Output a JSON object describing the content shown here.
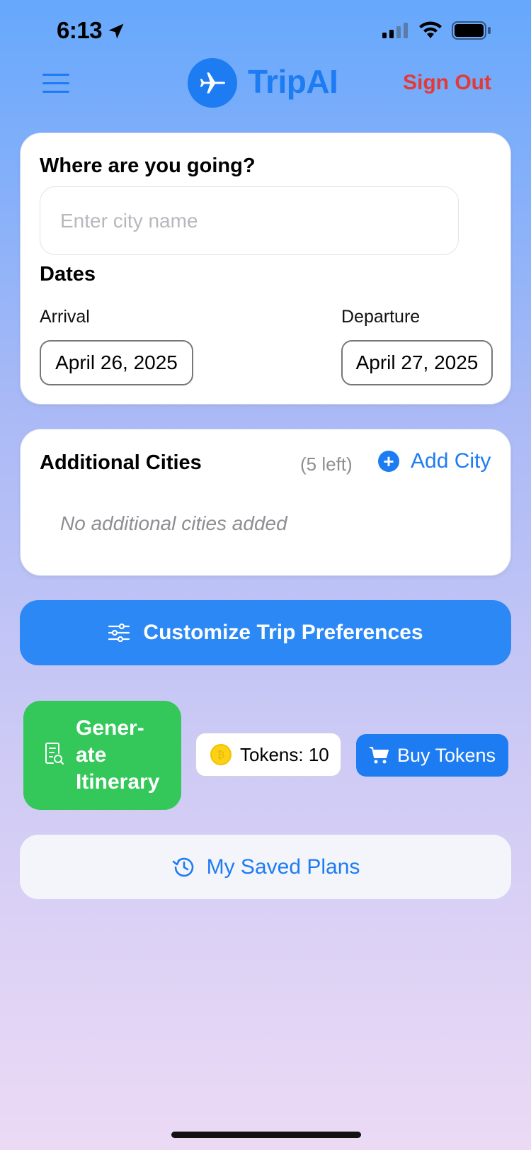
{
  "status_bar": {
    "time": "6:13"
  },
  "header": {
    "app_title": "TripAI",
    "sign_out_label": "Sign Out"
  },
  "destination": {
    "heading": "Where are you going?",
    "city_placeholder": "Enter city name",
    "city_value": "",
    "dates_heading": "Dates",
    "arrival_label": "Arrival",
    "arrival_value": "April 26, 2025",
    "departure_label": "Departure",
    "departure_value": "April 27, 2025"
  },
  "additional_cities": {
    "heading": "Additional Cities",
    "remaining": "(5 left)",
    "add_label": "Add City",
    "empty_text": "No additional cities added"
  },
  "actions": {
    "customize_label": "Customize Trip Preferences",
    "generate_label": "Gener-ate Itinerary",
    "tokens_label": "Tokens: 10",
    "buy_tokens_label": "Buy Tokens",
    "saved_plans_label": "My Saved Plans"
  },
  "colors": {
    "accent": "#1d7cf2",
    "sign_out": "#e53935",
    "generate": "#34c759",
    "customize": "#2b88f5"
  },
  "icons": [
    "location-arrow-icon",
    "signal-icon",
    "wifi-icon",
    "battery-icon",
    "menu-icon",
    "airplane-icon",
    "plus-circle-icon",
    "sliders-icon",
    "document-search-icon",
    "coin-icon",
    "cart-icon",
    "history-icon"
  ]
}
